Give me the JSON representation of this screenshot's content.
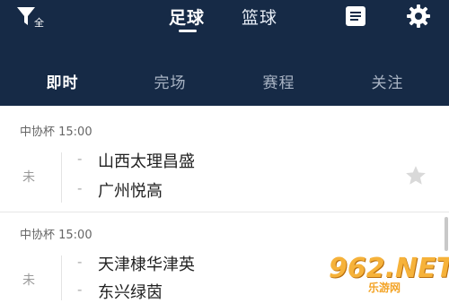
{
  "header": {
    "filter_label": "全",
    "sport_tabs": [
      {
        "label": "足球",
        "active": true
      },
      {
        "label": "篮球",
        "active": false
      }
    ],
    "icons": [
      "filter-icon",
      "document-icon",
      "gear-icon"
    ]
  },
  "sub_tabs": [
    {
      "label": "即时",
      "active": true
    },
    {
      "label": "完场",
      "active": false
    },
    {
      "label": "赛程",
      "active": false
    },
    {
      "label": "关注",
      "active": false
    }
  ],
  "matches": [
    {
      "league_time": "中协杯 15:00",
      "status": "未",
      "home_score": "-",
      "away_score": "-",
      "home_team": "山西太理昌盛",
      "away_team": "广州悦高"
    },
    {
      "league_time": "中协杯 15:00",
      "status": "未",
      "home_score": "-",
      "away_score": "-",
      "home_team": "天津棣华津英",
      "away_team": "东兴绿茵"
    }
  ],
  "watermark": {
    "main": "962.NET",
    "sub": "乐游网"
  },
  "colors": {
    "header_bg": "#162a46",
    "active_text": "#ffffff",
    "inactive_text": "#a9b4c4",
    "watermark": "#f6b23a"
  }
}
